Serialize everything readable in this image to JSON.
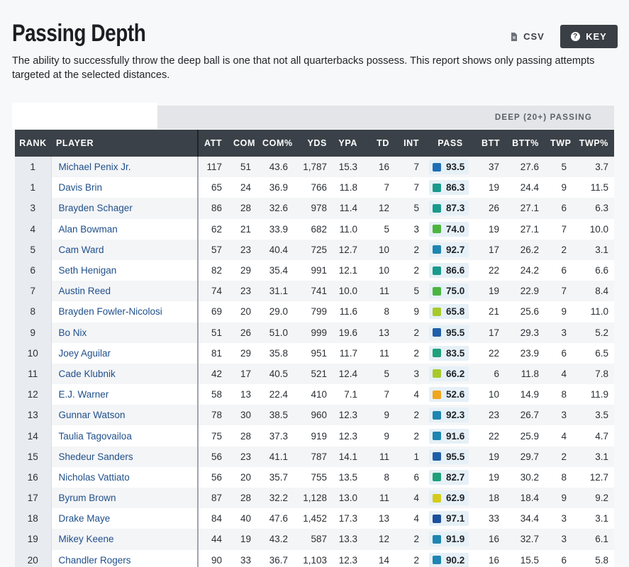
{
  "header": {
    "title": "Passing Depth",
    "description": "The ability to successfully throw the deep ball is one that not all quarterbacks possess. This report shows only passing attempts targeted at the selected distances.",
    "csv_label": "CSV",
    "key_label": "KEY"
  },
  "table": {
    "group_label": "DEEP (20+) PASSING",
    "columns": [
      "RANK",
      "PLAYER",
      "ATT",
      "COM",
      "COM%",
      "YDS",
      "YPA",
      "TD",
      "INT",
      "PASS",
      "BTT",
      "BTT%",
      "TWP",
      "TWP%"
    ],
    "rows": [
      {
        "rank": "1",
        "player": "Michael Penix Jr.",
        "att": "117",
        "com": "51",
        "com_pct": "43.6",
        "yds": "1,787",
        "ypa": "15.3",
        "td": "16",
        "int": "7",
        "pass": "93.5",
        "pass_color": "#1e6fb3",
        "btt": "37",
        "btt_pct": "27.6",
        "twp": "5",
        "twp_pct": "3.7"
      },
      {
        "rank": "1",
        "player": "Davis Brin",
        "att": "65",
        "com": "24",
        "com_pct": "36.9",
        "yds": "766",
        "ypa": "11.8",
        "td": "7",
        "int": "7",
        "pass": "86.3",
        "pass_color": "#1a9a8c",
        "btt": "19",
        "btt_pct": "24.4",
        "twp": "9",
        "twp_pct": "11.5"
      },
      {
        "rank": "3",
        "player": "Brayden Schager",
        "att": "86",
        "com": "28",
        "com_pct": "32.6",
        "yds": "978",
        "ypa": "11.4",
        "td": "12",
        "int": "5",
        "pass": "87.3",
        "pass_color": "#1a9a8c",
        "btt": "26",
        "btt_pct": "27.1",
        "twp": "6",
        "twp_pct": "6.3"
      },
      {
        "rank": "4",
        "player": "Alan Bowman",
        "att": "62",
        "com": "21",
        "com_pct": "33.9",
        "yds": "682",
        "ypa": "11.0",
        "td": "5",
        "int": "3",
        "pass": "74.0",
        "pass_color": "#4cb53f",
        "btt": "19",
        "btt_pct": "27.1",
        "twp": "7",
        "twp_pct": "10.0"
      },
      {
        "rank": "5",
        "player": "Cam Ward",
        "att": "57",
        "com": "23",
        "com_pct": "40.4",
        "yds": "725",
        "ypa": "12.7",
        "td": "10",
        "int": "2",
        "pass": "92.7",
        "pass_color": "#1e86b0",
        "btt": "17",
        "btt_pct": "26.2",
        "twp": "2",
        "twp_pct": "3.1"
      },
      {
        "rank": "6",
        "player": "Seth Henigan",
        "att": "82",
        "com": "29",
        "com_pct": "35.4",
        "yds": "991",
        "ypa": "12.1",
        "td": "10",
        "int": "2",
        "pass": "86.6",
        "pass_color": "#1a9a8c",
        "btt": "22",
        "btt_pct": "24.2",
        "twp": "6",
        "twp_pct": "6.6"
      },
      {
        "rank": "7",
        "player": "Austin Reed",
        "att": "74",
        "com": "23",
        "com_pct": "31.1",
        "yds": "741",
        "ypa": "10.0",
        "td": "11",
        "int": "5",
        "pass": "75.0",
        "pass_color": "#4cb53f",
        "btt": "19",
        "btt_pct": "22.9",
        "twp": "7",
        "twp_pct": "8.4"
      },
      {
        "rank": "8",
        "player": "Brayden Fowler-Nicolosi",
        "att": "69",
        "com": "20",
        "com_pct": "29.0",
        "yds": "799",
        "ypa": "11.6",
        "td": "8",
        "int": "9",
        "pass": "65.8",
        "pass_color": "#a8c92a",
        "btt": "21",
        "btt_pct": "25.6",
        "twp": "9",
        "twp_pct": "11.0"
      },
      {
        "rank": "9",
        "player": "Bo Nix",
        "att": "51",
        "com": "26",
        "com_pct": "51.0",
        "yds": "999",
        "ypa": "19.6",
        "td": "13",
        "int": "2",
        "pass": "95.5",
        "pass_color": "#1f5fa8",
        "btt": "17",
        "btt_pct": "29.3",
        "twp": "3",
        "twp_pct": "5.2"
      },
      {
        "rank": "10",
        "player": "Joey Aguilar",
        "att": "81",
        "com": "29",
        "com_pct": "35.8",
        "yds": "951",
        "ypa": "11.7",
        "td": "11",
        "int": "2",
        "pass": "83.5",
        "pass_color": "#1ea07a",
        "btt": "22",
        "btt_pct": "23.9",
        "twp": "6",
        "twp_pct": "6.5"
      },
      {
        "rank": "11",
        "player": "Cade Klubnik",
        "att": "42",
        "com": "17",
        "com_pct": "40.5",
        "yds": "521",
        "ypa": "12.4",
        "td": "5",
        "int": "3",
        "pass": "66.2",
        "pass_color": "#a8c92a",
        "btt": "6",
        "btt_pct": "11.8",
        "twp": "4",
        "twp_pct": "7.8"
      },
      {
        "rank": "12",
        "player": "E.J. Warner",
        "att": "58",
        "com": "13",
        "com_pct": "22.4",
        "yds": "410",
        "ypa": "7.1",
        "td": "7",
        "int": "4",
        "pass": "52.6",
        "pass_color": "#f0a61c",
        "btt": "10",
        "btt_pct": "14.9",
        "twp": "8",
        "twp_pct": "11.9"
      },
      {
        "rank": "13",
        "player": "Gunnar Watson",
        "att": "78",
        "com": "30",
        "com_pct": "38.5",
        "yds": "960",
        "ypa": "12.3",
        "td": "9",
        "int": "2",
        "pass": "92.3",
        "pass_color": "#1e86b0",
        "btt": "23",
        "btt_pct": "26.7",
        "twp": "3",
        "twp_pct": "3.5"
      },
      {
        "rank": "14",
        "player": "Taulia Tagovailoa",
        "att": "75",
        "com": "28",
        "com_pct": "37.3",
        "yds": "919",
        "ypa": "12.3",
        "td": "9",
        "int": "2",
        "pass": "91.6",
        "pass_color": "#1e86b0",
        "btt": "22",
        "btt_pct": "25.9",
        "twp": "4",
        "twp_pct": "4.7"
      },
      {
        "rank": "15",
        "player": "Shedeur Sanders",
        "att": "56",
        "com": "23",
        "com_pct": "41.1",
        "yds": "787",
        "ypa": "14.1",
        "td": "11",
        "int": "1",
        "pass": "95.5",
        "pass_color": "#1f5fa8",
        "btt": "19",
        "btt_pct": "29.7",
        "twp": "2",
        "twp_pct": "3.1"
      },
      {
        "rank": "16",
        "player": "Nicholas Vattiato",
        "att": "56",
        "com": "20",
        "com_pct": "35.7",
        "yds": "755",
        "ypa": "13.5",
        "td": "8",
        "int": "6",
        "pass": "82.7",
        "pass_color": "#1ea07a",
        "btt": "19",
        "btt_pct": "30.2",
        "twp": "8",
        "twp_pct": "12.7"
      },
      {
        "rank": "17",
        "player": "Byrum Brown",
        "att": "87",
        "com": "28",
        "com_pct": "32.2",
        "yds": "1,128",
        "ypa": "13.0",
        "td": "11",
        "int": "4",
        "pass": "62.9",
        "pass_color": "#d4cc1c",
        "btt": "18",
        "btt_pct": "18.4",
        "twp": "9",
        "twp_pct": "9.2"
      },
      {
        "rank": "18",
        "player": "Drake Maye",
        "att": "84",
        "com": "40",
        "com_pct": "47.6",
        "yds": "1,452",
        "ypa": "17.3",
        "td": "13",
        "int": "4",
        "pass": "97.1",
        "pass_color": "#1c4f9c",
        "btt": "33",
        "btt_pct": "34.4",
        "twp": "3",
        "twp_pct": "3.1"
      },
      {
        "rank": "19",
        "player": "Mikey Keene",
        "att": "44",
        "com": "19",
        "com_pct": "43.2",
        "yds": "587",
        "ypa": "13.3",
        "td": "12",
        "int": "2",
        "pass": "91.9",
        "pass_color": "#1e86b0",
        "btt": "16",
        "btt_pct": "32.7",
        "twp": "3",
        "twp_pct": "6.1"
      },
      {
        "rank": "20",
        "player": "Chandler Rogers",
        "att": "90",
        "com": "33",
        "com_pct": "36.7",
        "yds": "1,103",
        "ypa": "12.3",
        "td": "14",
        "int": "2",
        "pass": "90.2",
        "pass_color": "#1e86b0",
        "btt": "16",
        "btt_pct": "15.5",
        "twp": "6",
        "twp_pct": "5.8"
      }
    ]
  }
}
